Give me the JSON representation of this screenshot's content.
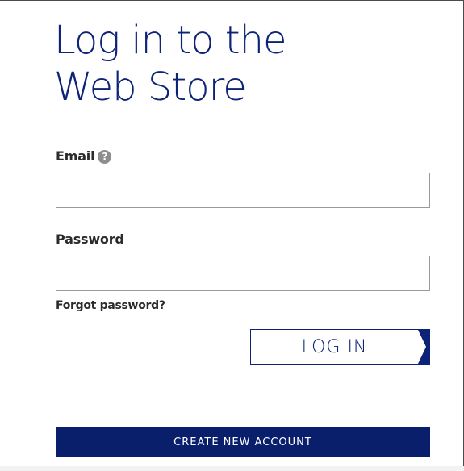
{
  "page": {
    "title_line1": "Log in to the",
    "title_line2": "Web Store"
  },
  "form": {
    "email_label": "Email",
    "email_help_icon": "question-circle-icon",
    "email_help_glyph": "?",
    "email_value": "",
    "password_label": "Password",
    "password_value": "",
    "forgot_password_link": "Forgot password?",
    "login_button": "LOG IN",
    "create_account_button": "CREATE NEW ACCOUNT"
  },
  "colors": {
    "brand_navy": "#0c2377",
    "button_fill": "#0a1f6c",
    "label_text": "#2b2b2b",
    "input_border": "#9a9a9a",
    "help_icon": "#8e8e8e"
  }
}
